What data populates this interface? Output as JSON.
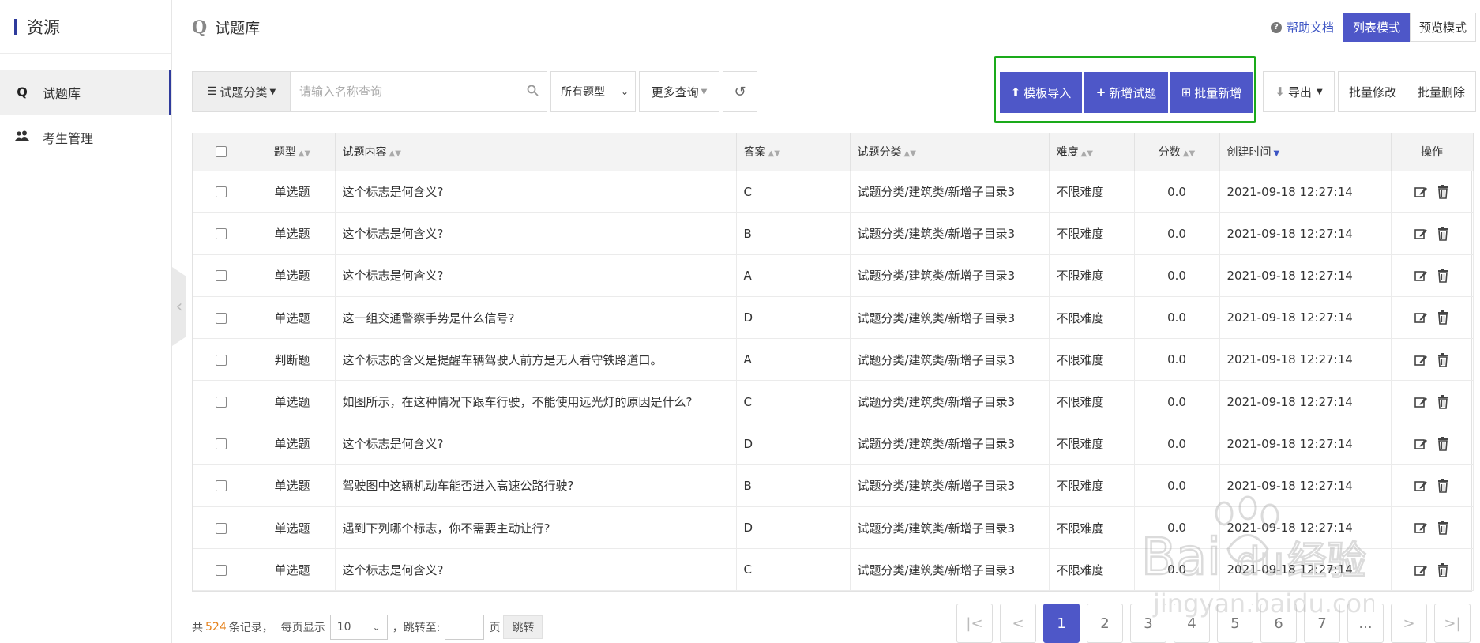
{
  "sidebar": {
    "title": "资源",
    "items": [
      {
        "label": "试题库",
        "icon": "Q",
        "active": true
      },
      {
        "label": "考生管理",
        "icon": "users-icon",
        "active": false
      }
    ]
  },
  "header": {
    "title_icon": "Q",
    "title": "试题库",
    "help": "帮助文档",
    "mode_list": "列表模式",
    "mode_preview": "预览模式"
  },
  "toolbar": {
    "category": "试题分类",
    "search_placeholder": "请输入名称查询",
    "type_select": "所有题型",
    "more_query": "更多查询",
    "template_import": "模板导入",
    "add_question": "新增试题",
    "batch_add": "批量新增",
    "export": "导出",
    "batch_edit": "批量修改",
    "batch_delete": "批量删除"
  },
  "table": {
    "columns": [
      "题型",
      "试题内容",
      "答案",
      "试题分类",
      "难度",
      "分数",
      "创建时间",
      "操作"
    ],
    "rows": [
      {
        "type": "单选题",
        "content": "这个标志是何含义?",
        "answer": "C",
        "category": "试题分类/建筑类/新增子目录3",
        "difficulty": "不限难度",
        "score": "0.0",
        "created": "2021-09-18 12:27:14"
      },
      {
        "type": "单选题",
        "content": "这个标志是何含义?",
        "answer": "B",
        "category": "试题分类/建筑类/新增子目录3",
        "difficulty": "不限难度",
        "score": "0.0",
        "created": "2021-09-18 12:27:14"
      },
      {
        "type": "单选题",
        "content": "这个标志是何含义?",
        "answer": "A",
        "category": "试题分类/建筑类/新增子目录3",
        "difficulty": "不限难度",
        "score": "0.0",
        "created": "2021-09-18 12:27:14"
      },
      {
        "type": "单选题",
        "content": "这一组交通警察手势是什么信号?",
        "answer": "D",
        "category": "试题分类/建筑类/新增子目录3",
        "difficulty": "不限难度",
        "score": "0.0",
        "created": "2021-09-18 12:27:14"
      },
      {
        "type": "判断题",
        "content": "这个标志的含义是提醒车辆驾驶人前方是无人看守铁路道口。",
        "answer": "A",
        "category": "试题分类/建筑类/新增子目录3",
        "difficulty": "不限难度",
        "score": "0.0",
        "created": "2021-09-18 12:27:14"
      },
      {
        "type": "单选题",
        "content": "如图所示，在这种情况下跟车行驶，不能使用远光灯的原因是什么?",
        "answer": "C",
        "category": "试题分类/建筑类/新增子目录3",
        "difficulty": "不限难度",
        "score": "0.0",
        "created": "2021-09-18 12:27:14"
      },
      {
        "type": "单选题",
        "content": "这个标志是何含义?",
        "answer": "D",
        "category": "试题分类/建筑类/新增子目录3",
        "difficulty": "不限难度",
        "score": "0.0",
        "created": "2021-09-18 12:27:14"
      },
      {
        "type": "单选题",
        "content": "驾驶图中这辆机动车能否进入高速公路行驶?",
        "answer": "B",
        "category": "试题分类/建筑类/新增子目录3",
        "difficulty": "不限难度",
        "score": "0.0",
        "created": "2021-09-18 12:27:14"
      },
      {
        "type": "单选题",
        "content": "遇到下列哪个标志，你不需要主动让行?",
        "answer": "D",
        "category": "试题分类/建筑类/新增子目录3",
        "difficulty": "不限难度",
        "score": "0.0",
        "created": "2021-09-18 12:27:14"
      },
      {
        "type": "单选题",
        "content": "这个标志是何含义?",
        "answer": "C",
        "category": "试题分类/建筑类/新增子目录3",
        "difficulty": "不限难度",
        "score": "0.0",
        "created": "2021-09-18 12:27:14"
      }
    ]
  },
  "footer": {
    "total_prefix": "共",
    "total": "524",
    "total_suffix": "条记录，",
    "page_size_label": "每页显示",
    "page_size": "10",
    "jump_label": "，跳转至:",
    "page_unit": "页",
    "jump_button": "跳转"
  },
  "pagination": {
    "first": "|<",
    "prev": "<",
    "pages": [
      "1",
      "2",
      "3",
      "4",
      "5",
      "6",
      "7"
    ],
    "current": "1",
    "ellipsis": "...",
    "next": ">",
    "last": ">|"
  },
  "watermark": {
    "brand": "Bai du 经验",
    "url": "jingyan.baidu.com"
  },
  "colors": {
    "primary": "#4e57c8",
    "highlight": "#1aaa1a",
    "count": "#e5811b",
    "link": "#3d55c4"
  }
}
